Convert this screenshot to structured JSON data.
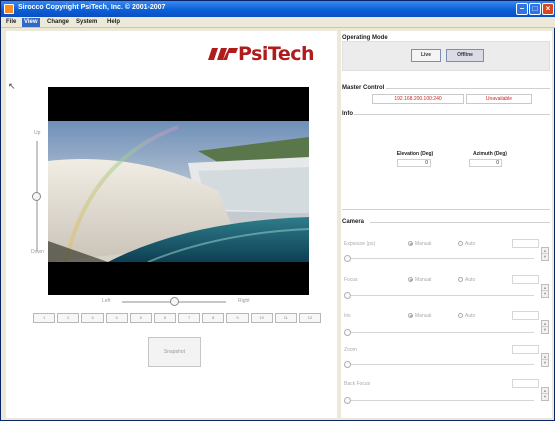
{
  "window": {
    "title": "Sirocco  Copyright PsiTech, Inc. © 2001-2007",
    "controls": {
      "minimize": "–",
      "maximize": "□",
      "close": "×"
    }
  },
  "menu": [
    "File",
    "View",
    "Change",
    "System",
    "Help"
  ],
  "logo": {
    "text": "PsiTech"
  },
  "video": {
    "tilt_up_label": "Up",
    "tilt_down_label": "Down",
    "pan_left_label": "Left",
    "pan_right_label": "Right",
    "tilt_position": 0.5,
    "pan_position": 0.5
  },
  "presets": [
    "1",
    "2",
    "3",
    "4",
    "5",
    "6",
    "7",
    "8",
    "9",
    "10",
    "11",
    "12"
  ],
  "snapshot_label": "Snapshot",
  "operating_mode": {
    "title": "Operating Mode",
    "live_label": "Live",
    "offline_label": "Offline"
  },
  "master_control": {
    "title": "Master Control",
    "ip": "192.168.200.100:240",
    "status": "Unavailable"
  },
  "info": {
    "title": "Info",
    "elevation_label": "Elevation (Deg)",
    "elevation_value": "0",
    "azimuth_label": "Azimuth (Deg)",
    "azimuth_value": "0"
  },
  "camera": {
    "title": "Camera",
    "exposure_label": "Exposure (ps)",
    "focus_label": "Focus",
    "iris_label": "Iris",
    "zoom_label": "Zoom",
    "back_focus_label": "Back Focus",
    "manual_label": "Manual",
    "auto_label": "Auto",
    "spin_up": "▲",
    "spin_down": "▼"
  },
  "colors": {
    "titlebar": "#0a5fd8",
    "logo": "#b01c1c",
    "status_text": "#d02020"
  }
}
